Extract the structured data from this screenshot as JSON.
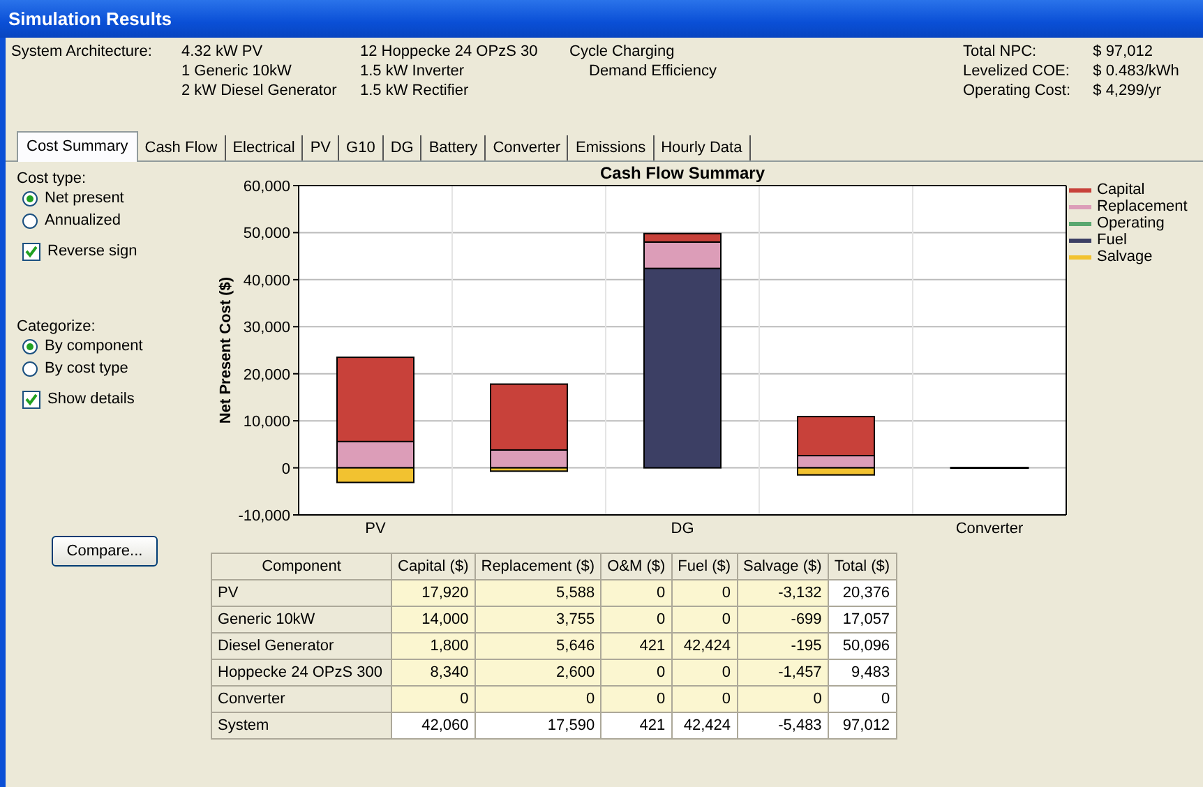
{
  "window": {
    "title": "Simulation Results"
  },
  "architecture": {
    "label": "System Architecture:",
    "column_1": [
      "4.32 kW PV",
      "1 Generic 10kW",
      "2 kW Diesel Generator"
    ],
    "column_2": [
      "12 Hoppecke 24 OPzS 30",
      "1.5 kW Inverter",
      "1.5 kW Rectifier"
    ],
    "column_3": [
      "Cycle Charging",
      "Demand Efficiency"
    ]
  },
  "totals": [
    {
      "label": "Total NPC:",
      "value": "$ 97,012"
    },
    {
      "label": "Levelized COE:",
      "value": "$ 0.483/kWh"
    },
    {
      "label": "Operating Cost:",
      "value": "$ 4,299/yr"
    }
  ],
  "tabs": [
    {
      "label": "Cost Summary",
      "selected": true
    },
    {
      "label": "Cash Flow",
      "selected": false
    },
    {
      "label": "Electrical",
      "selected": false
    },
    {
      "label": "PV",
      "selected": false
    },
    {
      "label": "G10",
      "selected": false
    },
    {
      "label": "DG",
      "selected": false
    },
    {
      "label": "Battery",
      "selected": false
    },
    {
      "label": "Converter",
      "selected": false
    },
    {
      "label": "Emissions",
      "selected": false
    },
    {
      "label": "Hourly Data",
      "selected": false
    }
  ],
  "cost_type": {
    "label": "Cost type:",
    "options": [
      {
        "label": "Net present",
        "selected": true
      },
      {
        "label": "Annualized",
        "selected": false
      }
    ],
    "reverse_sign": {
      "label": "Reverse sign",
      "checked": true
    }
  },
  "categorize": {
    "label": "Categorize:",
    "options": [
      {
        "label": "By component",
        "selected": true
      },
      {
        "label": "By cost type",
        "selected": false
      }
    ],
    "show_details": {
      "label": "Show details",
      "checked": true
    }
  },
  "compare_button": "Compare...",
  "chart_data": {
    "type": "bar",
    "stacked": true,
    "grid": true,
    "legend": true,
    "title": "Cash Flow Summary",
    "ylabel": "Net Present Cost ($)",
    "categories": [
      "PV",
      null,
      "DG",
      null,
      "Converter"
    ],
    "ylim": [
      -10000,
      60000
    ],
    "yticks": [
      {
        "value": -10000,
        "label": "-10,000"
      },
      {
        "value": 0,
        "label": "0"
      },
      {
        "value": 10000,
        "label": "10,000"
      },
      {
        "value": 20000,
        "label": "20,000"
      },
      {
        "value": 30000,
        "label": "30,000"
      },
      {
        "value": 40000,
        "label": "40,000"
      },
      {
        "value": 50000,
        "label": "50,000"
      },
      {
        "value": 60000,
        "label": "60,000"
      }
    ],
    "series": [
      {
        "name": "Capital",
        "color": "#c8413a",
        "values": [
          17900,
          14000,
          1800,
          8300,
          0
        ]
      },
      {
        "name": "Replacement",
        "color": "#dc9db8",
        "values": [
          5600,
          3800,
          5600,
          2600,
          0
        ]
      },
      {
        "name": "Operating",
        "color": "#5aa870",
        "values": [
          0,
          0,
          0,
          0,
          0
        ]
      },
      {
        "name": "Fuel",
        "color": "#3c3f64",
        "values": [
          0,
          0,
          42400,
          0,
          0
        ]
      },
      {
        "name": "Salvage",
        "color": "#f2c230",
        "values": [
          -3100,
          -700,
          null,
          -1500,
          0
        ]
      }
    ]
  },
  "table": {
    "columns": [
      "Component",
      "Capital ($)",
      "Replacement ($)",
      "O&M ($)",
      "Fuel ($)",
      "Salvage ($)",
      "Total ($)"
    ],
    "rows": [
      {
        "kind": "component",
        "cells": [
          "PV",
          "17,920",
          "5,588",
          "0",
          "0",
          "-3,132",
          "20,376"
        ]
      },
      {
        "kind": "component",
        "cells": [
          "Generic 10kW",
          "14,000",
          "3,755",
          "0",
          "0",
          "-699",
          "17,057"
        ]
      },
      {
        "kind": "component",
        "cells": [
          "Diesel Generator",
          "1,800",
          "5,646",
          "421",
          "42,424",
          "-195",
          "50,096"
        ]
      },
      {
        "kind": "component",
        "cells": [
          "Hoppecke 24 OPzS 300",
          "8,340",
          "2,600",
          "0",
          "0",
          "-1,457",
          "9,483"
        ]
      },
      {
        "kind": "component",
        "cells": [
          "Converter",
          "0",
          "0",
          "0",
          "0",
          "0",
          "0"
        ]
      },
      {
        "kind": "total",
        "cells": [
          "System",
          "42,060",
          "17,590",
          "421",
          "42,424",
          "-5,483",
          "97,012"
        ]
      }
    ]
  }
}
